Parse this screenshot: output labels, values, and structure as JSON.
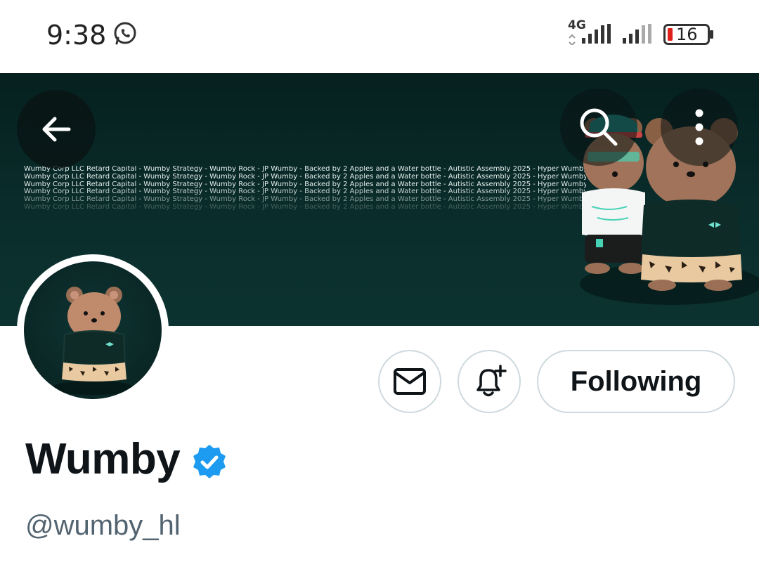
{
  "status_bar": {
    "time": "9:38",
    "network_type": "4G",
    "battery_level": "16",
    "icons": [
      "whatsapp-icon",
      "signal-sim1-icon",
      "signal-sim2-icon",
      "battery-icon"
    ]
  },
  "header": {
    "back_icon": "arrow-left-icon",
    "search_icon": "search-icon",
    "more_icon": "more-vertical-icon"
  },
  "banner": {
    "text_lines": [
      "Wumby Corp LLC Retard Capital - Wumby Strategy - Wumby Rock - JP Wumby - Backed by 2 Apples and a Water bottle - Autistic Assembly 2025 - Hyper Wumby",
      "Wumby Corp LLC Retard Capital - Wumby Strategy - Wumby Rock - JP Wumby - Backed by 2 Apples and a Water bottle - Autistic Assembly 2025 - Hyper Wumby",
      "Wumby Corp LLC Retard Capital - Wumby Strategy - Wumby Rock - JP Wumby - Backed by 2 Apples and a Water bottle - Autistic Assembly 2025 - Hyper Wumby",
      "Wumby Corp LLC Retard Capital - Wumby Strategy - Wumby Rock - JP Wumby - Backed by 2 Apples and a Water bottle - Autistic Assembly 2025 - Hyper Wumby",
      "Wumby Corp LLC Retard Capital - Wumby Strategy - Wumby Rock - JP Wumby - Backed by 2 Apples and a Water bottle - Autistic Assembly 2025 - Hyper Wumby",
      "Wumby Corp LLC Retard Capital - Wumby Strategy - Wumby Rock - JP Wumby - Backed by 2 Apples and a Water bottle - Autistic Assembly 2025 - Hyper Wumby"
    ]
  },
  "profile": {
    "display_name": "Wumby",
    "handle": "@wumby_hl",
    "verified": true
  },
  "actions": {
    "message_icon": "mail-icon",
    "notify_icon": "bell-plus-icon",
    "follow_label": "Following"
  },
  "colors": {
    "banner_bg": "#0a2d2b",
    "verified_blue": "#1d9bf0",
    "handle_gray": "#536471",
    "border_gray": "#cfd9de",
    "battery_low": "#e0201b"
  }
}
